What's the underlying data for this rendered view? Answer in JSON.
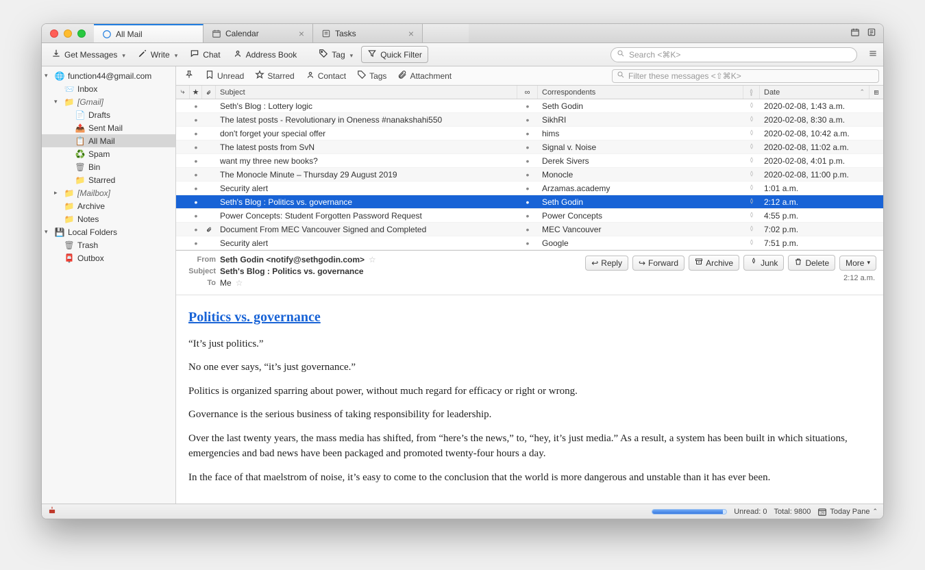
{
  "tabs": [
    {
      "label": "All Mail",
      "active": true,
      "icon": "mail"
    },
    {
      "label": "Calendar",
      "active": false,
      "icon": "calendar",
      "closable": true
    },
    {
      "label": "Tasks",
      "active": false,
      "icon": "tasks",
      "closable": true
    }
  ],
  "toolbar": {
    "get_messages": "Get Messages",
    "write": "Write",
    "chat": "Chat",
    "address_book": "Address Book",
    "tag": "Tag",
    "quick_filter": "Quick Filter",
    "search_placeholder": "Search <⌘K>"
  },
  "filterbar": {
    "unread": "Unread",
    "starred": "Starred",
    "contact": "Contact",
    "tags": "Tags",
    "attachment": "Attachment",
    "filter_placeholder": "Filter these messages <⇧⌘K>"
  },
  "folder_tree": [
    {
      "depth": 0,
      "label": "function44@gmail.com",
      "icon": "account",
      "twisty": "▾"
    },
    {
      "depth": 1,
      "label": "Inbox",
      "icon": "inbox"
    },
    {
      "depth": 1,
      "label": "[Gmail]",
      "icon": "folder",
      "italic": true,
      "twisty": "▾"
    },
    {
      "depth": 2,
      "label": "Drafts",
      "icon": "drafts"
    },
    {
      "depth": 2,
      "label": "Sent Mail",
      "icon": "sent"
    },
    {
      "depth": 2,
      "label": "All Mail",
      "icon": "allmail",
      "selected": true
    },
    {
      "depth": 2,
      "label": "Spam",
      "icon": "spam"
    },
    {
      "depth": 2,
      "label": "Bin",
      "icon": "trash"
    },
    {
      "depth": 2,
      "label": "Starred",
      "icon": "folder"
    },
    {
      "depth": 1,
      "label": "[Mailbox]",
      "icon": "folder",
      "italic": true,
      "twisty": "▸"
    },
    {
      "depth": 1,
      "label": "Archive",
      "icon": "folder"
    },
    {
      "depth": 1,
      "label": "Notes",
      "icon": "folder"
    },
    {
      "depth": 0,
      "label": "Local Folders",
      "icon": "local",
      "twisty": "▾"
    },
    {
      "depth": 1,
      "label": "Trash",
      "icon": "trash"
    },
    {
      "depth": 1,
      "label": "Outbox",
      "icon": "outbox"
    }
  ],
  "columns": {
    "subject": "Subject",
    "correspondents": "Correspondents",
    "date": "Date"
  },
  "messages": [
    {
      "subject": "Seth's Blog : Lottery logic",
      "from": "Seth Godin",
      "date": "2020-02-08, 1:43 a.m."
    },
    {
      "subject": "The latest posts - Revolutionary in Oneness #nanakshahi550",
      "from": "SikhRI",
      "date": "2020-02-08, 8:30 a.m."
    },
    {
      "subject": "don't forget your special offer",
      "from": "hims",
      "date": "2020-02-08, 10:42 a.m."
    },
    {
      "subject": "The latest posts from SvN",
      "from": "Signal v. Noise",
      "date": "2020-02-08, 11:02 a.m."
    },
    {
      "subject": "want my three new books?",
      "from": "Derek Sivers",
      "date": "2020-02-08, 4:01 p.m."
    },
    {
      "subject": "The Monocle Minute – Thursday 29 August 2019",
      "from": "Monocle",
      "date": "2020-02-08, 11:00 p.m."
    },
    {
      "subject": "Security alert",
      "from": "Arzamas.academy",
      "date": "1:01 a.m."
    },
    {
      "subject": "Seth's Blog : Politics vs. governance",
      "from": "Seth Godin",
      "date": "2:12 a.m.",
      "selected": true
    },
    {
      "subject": "Power Concepts: Student Forgotten Password Request",
      "from": "Power Concepts",
      "date": "4:55 p.m."
    },
    {
      "subject": "Document From MEC Vancouver Signed and Completed",
      "from": "MEC Vancouver",
      "date": "7:02 p.m.",
      "attach": true
    },
    {
      "subject": "Security alert",
      "from": "Google",
      "date": "7:51 p.m."
    }
  ],
  "preview": {
    "labels": {
      "from": "From",
      "subject": "Subject",
      "to": "To"
    },
    "from_display": "Seth Godin <notify@sethgodin.com>",
    "subject": "Seth's Blog : Politics vs. governance",
    "to": "Me",
    "time": "2:12 a.m.",
    "actions": {
      "reply": "Reply",
      "forward": "Forward",
      "archive": "Archive",
      "junk": "Junk",
      "delete": "Delete",
      "more": "More"
    },
    "article_title": "Politics vs. governance",
    "paragraphs": [
      "“It’s just politics.”",
      "No one ever says, “it’s just governance.”",
      "Politics is organized sparring about power, without much regard for efficacy or right or wrong.",
      "Governance is the serious business of taking responsibility for leadership.",
      "Over the last twenty years, the mass media has shifted, from “here’s the news,” to, “hey, it’s just media.” As a result, a system has been built in which situations, emergencies and bad news have been packaged and promoted twenty-four hours a day.",
      "In the face of that maelstrom of noise, it’s easy to come to the conclusion that the world is more dangerous and unstable than it has ever been."
    ]
  },
  "statusbar": {
    "unread_label": "Unread: 0",
    "total_label": "Total: 9800",
    "today_pane": "Today Pane"
  }
}
